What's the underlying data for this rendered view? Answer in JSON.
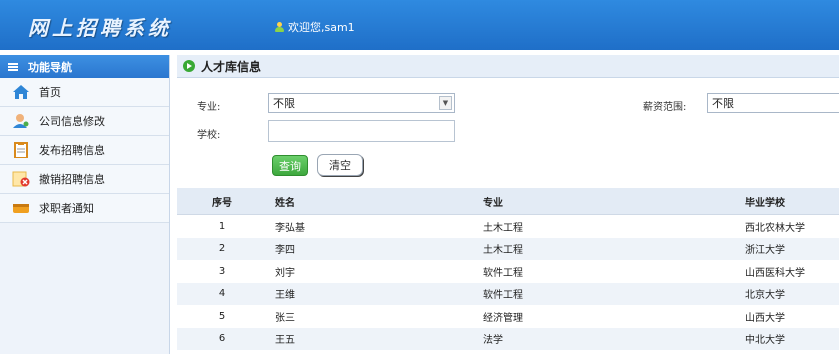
{
  "app": {
    "title": "网上招聘系统",
    "welcome": "欢迎您,sam1"
  },
  "sidebar": {
    "header": "功能导航",
    "items": [
      {
        "label": "首页",
        "icon": "home-icon"
      },
      {
        "label": "公司信息修改",
        "icon": "user-edit-icon"
      },
      {
        "label": "发布招聘信息",
        "icon": "clipboard-icon"
      },
      {
        "label": "撤销招聘信息",
        "icon": "revoke-document-icon"
      },
      {
        "label": "求职者通知",
        "icon": "message-icon"
      }
    ]
  },
  "panel": {
    "title": "人才库信息"
  },
  "form": {
    "major_label": "专业:",
    "major_value": "不限",
    "salary_label": "薪资范围:",
    "salary_value": "不限",
    "school_label": "学校:",
    "school_value": "",
    "query_label": "查询",
    "clear_label": "清空"
  },
  "table": {
    "headers": [
      "序号",
      "姓名",
      "专业",
      "毕业学校"
    ],
    "rows": [
      [
        "1",
        "李弘基",
        "土木工程",
        "西北农林大学"
      ],
      [
        "2",
        "李四",
        "土木工程",
        "浙江大学"
      ],
      [
        "3",
        "刘宇",
        "软件工程",
        "山西医科大学"
      ],
      [
        "4",
        "王维",
        "软件工程",
        "北京大学"
      ],
      [
        "5",
        "张三",
        "经济管理",
        "山西大学"
      ],
      [
        "6",
        "王五",
        "法学",
        "中北大学"
      ]
    ]
  },
  "colors": {
    "header_blue": "#2f8ae0",
    "query_green": "#3ea83e"
  }
}
